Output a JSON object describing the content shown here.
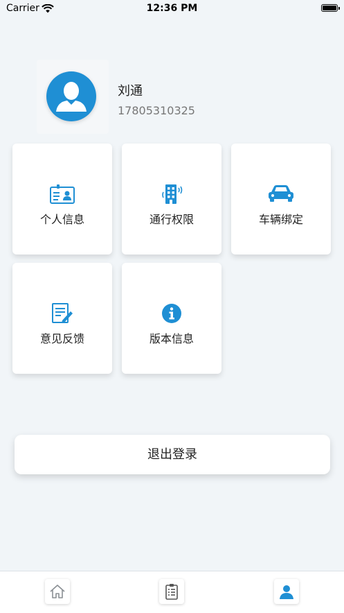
{
  "status": {
    "carrier": "Carrier",
    "time": "12:36 PM"
  },
  "profile": {
    "name": "刘通",
    "phone": "17805310325"
  },
  "menu": [
    {
      "label": "个人信息",
      "icon": "id-card-icon"
    },
    {
      "label": "通行权限",
      "icon": "building-access-icon"
    },
    {
      "label": "车辆绑定",
      "icon": "car-icon"
    },
    {
      "label": "意见反馈",
      "icon": "feedback-edit-icon"
    },
    {
      "label": "版本信息",
      "icon": "info-icon"
    }
  ],
  "logout_label": "退出登录",
  "tabbar": [
    {
      "icon": "home-icon"
    },
    {
      "icon": "clipboard-list-icon"
    },
    {
      "icon": "user-profile-icon",
      "active": true
    }
  ],
  "colors": {
    "accent": "#1f8fd4",
    "background": "#f1f5f8"
  }
}
